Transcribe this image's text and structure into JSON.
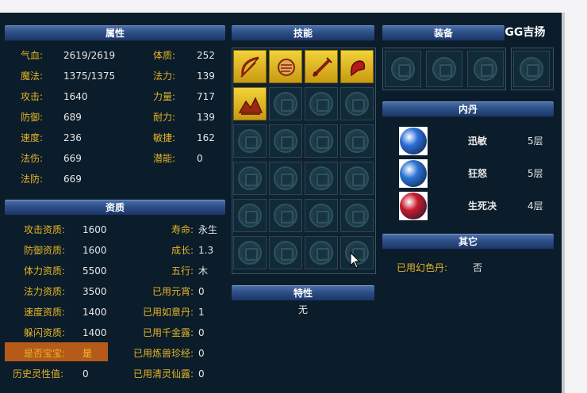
{
  "headers": {
    "attributes": "属性",
    "skills": "技能",
    "equipment": "装备",
    "inner_dan": "内丹",
    "aptitude": "资质",
    "traits": "特性",
    "other": "其它"
  },
  "watermark": "G GG吉扬",
  "attributes_left": [
    {
      "label": "气血:",
      "value": "2619/2619"
    },
    {
      "label": "魔法:",
      "value": "1375/1375"
    },
    {
      "label": "攻击:",
      "value": "1640"
    },
    {
      "label": "防御:",
      "value": "689"
    },
    {
      "label": "速度:",
      "value": "236"
    },
    {
      "label": "法伤:",
      "value": "669"
    },
    {
      "label": "法防:",
      "value": "669"
    }
  ],
  "attributes_right": [
    {
      "label": "体质:",
      "value": "252"
    },
    {
      "label": "法力:",
      "value": "139"
    },
    {
      "label": "力量:",
      "value": "717"
    },
    {
      "label": "耐力:",
      "value": "139"
    },
    {
      "label": "敏捷:",
      "value": "162"
    },
    {
      "label": "潜能:",
      "value": "0"
    }
  ],
  "aptitude_left": [
    {
      "label": "攻击资质:",
      "value": "1600"
    },
    {
      "label": "防御资质:",
      "value": "1600"
    },
    {
      "label": "体力资质:",
      "value": "5500"
    },
    {
      "label": "法力资质:",
      "value": "3500"
    },
    {
      "label": "速度资质:",
      "value": "1400"
    },
    {
      "label": "躲闪资质:",
      "value": "1400"
    },
    {
      "label": "是否宝宝:",
      "value": "是"
    },
    {
      "label": "历史灵性值:",
      "value": "0"
    }
  ],
  "aptitude_right": [
    {
      "label": "寿命:",
      "value": "永生"
    },
    {
      "label": "成长:",
      "value": "1.3"
    },
    {
      "label": "五行:",
      "value": "木"
    },
    {
      "label": "已用元宵:",
      "value": "0"
    },
    {
      "label": "已用如意丹:",
      "value": "1"
    },
    {
      "label": "已用千金露:",
      "value": "0"
    },
    {
      "label": "已用炼兽珍经:",
      "value": "0"
    },
    {
      "label": "已用清灵仙露:",
      "value": "0"
    }
  ],
  "skills": [
    {
      "icon": "bow-skill-icon"
    },
    {
      "icon": "fist-skill-icon"
    },
    {
      "icon": "sword-skill-icon"
    },
    {
      "icon": "arm-skill-icon"
    },
    {
      "icon": "mountain-skill-icon"
    }
  ],
  "traits_value": "无",
  "inner_dan": [
    {
      "name": "迅敏",
      "level": "5层",
      "color": "#2c6fd8"
    },
    {
      "name": "狂怒",
      "level": "5层",
      "color": "#2b74d4"
    },
    {
      "name": "生死决",
      "level": "4层",
      "color": "#c81a2a"
    }
  ],
  "other": {
    "label": "已用幻色丹:",
    "value": "否"
  },
  "colors": {
    "label": "#e3b527",
    "value": "#e8e8e8",
    "header": "#2d4f86",
    "highlight": "#b65a1a",
    "yes": "#f4c430"
  }
}
